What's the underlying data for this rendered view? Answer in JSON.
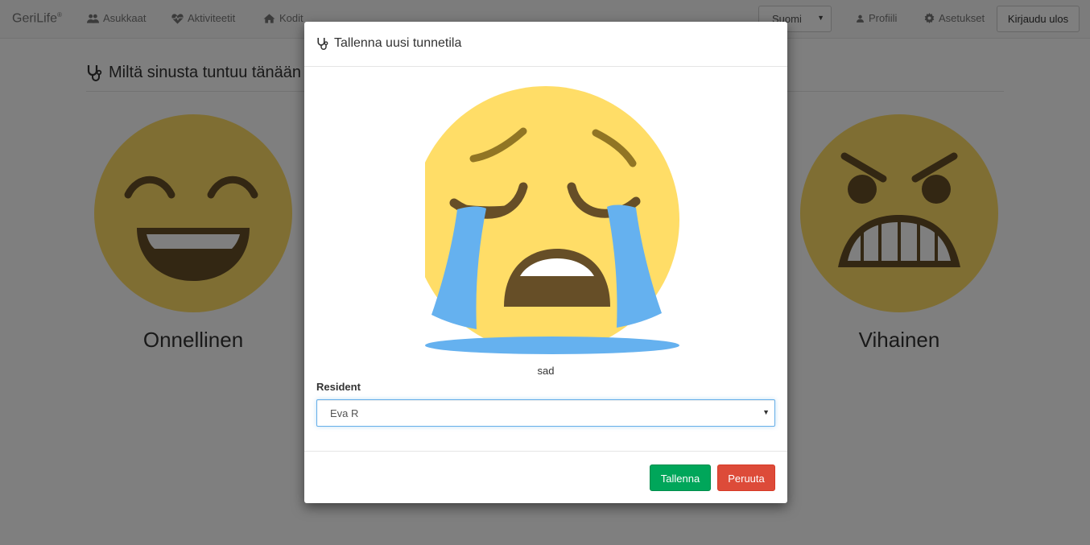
{
  "navbar": {
    "brand": "GeriLife",
    "brand_mark": "®",
    "links": [
      {
        "label": "Asukkaat",
        "icon": "users-icon"
      },
      {
        "label": "Aktiviteetit",
        "icon": "heartbeat-icon"
      },
      {
        "label": "Kodit",
        "icon": "home-icon"
      }
    ],
    "language": "Suomi",
    "profile_label": "Profiili",
    "settings_label": "Asetukset",
    "logout_label": "Kirjaudu ulos"
  },
  "page": {
    "title": "Miltä sinusta tuntuu tänään",
    "emotions": [
      {
        "label": "Onnellinen",
        "icon": "laughing-face-icon"
      },
      {
        "label": "Vihainen",
        "icon": "angry-face-icon"
      }
    ]
  },
  "modal": {
    "title": "Tallenna uusi tunnetila",
    "title_icon": "stethoscope-icon",
    "emoji_icon": "crying-face-icon",
    "emotion_name": "sad",
    "resident_label": "Resident",
    "resident_value": "Eva R",
    "save_label": "Tallenna",
    "cancel_label": "Peruuta"
  },
  "colors": {
    "backdrop": "rgba(0,0,0,0.5)",
    "emoji_yellow": "#ffdd67",
    "tear_blue": "#65b1ef",
    "emoji_brown": "#664e27",
    "save_green": "#00a65a",
    "cancel_red": "#dd4b39"
  }
}
